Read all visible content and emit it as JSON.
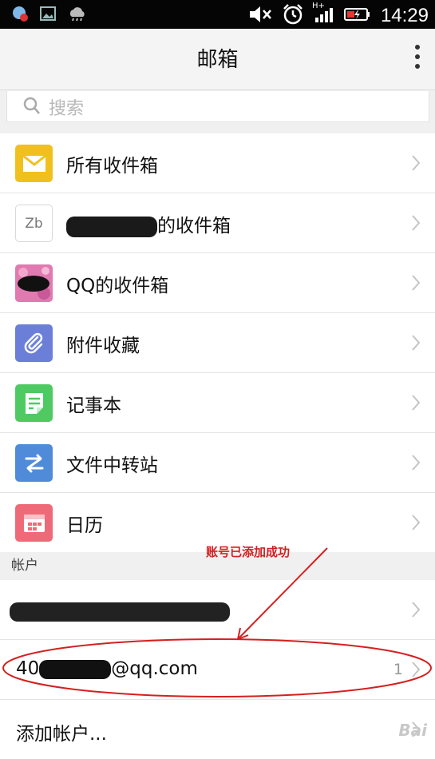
{
  "status_bar": {
    "time": "14:29",
    "network": "H+"
  },
  "header": {
    "title": "邮箱"
  },
  "search": {
    "placeholder": "搜索"
  },
  "folders": [
    {
      "label": "所有收件箱",
      "icon": "envelope-icon",
      "color": "#f2c01d"
    },
    {
      "label": "的收件箱",
      "icon": "avatar-zb",
      "icon_text": "Zb",
      "color": "#ffffff"
    },
    {
      "label": "QQ的收件箱",
      "icon": "avatar-photo",
      "color": "#e07ab0"
    },
    {
      "label": "附件收藏",
      "icon": "paperclip-icon",
      "color": "#6b7fd8"
    },
    {
      "label": "记事本",
      "icon": "note-icon",
      "color": "#4fca63"
    },
    {
      "label": "文件中转站",
      "icon": "transfer-icon",
      "color": "#4f8bd8"
    },
    {
      "label": "日历",
      "icon": "calendar-icon",
      "color": "#ef6a78"
    }
  ],
  "accounts_section": {
    "title": "帐户"
  },
  "accounts": [
    {
      "label": "",
      "count": ""
    },
    {
      "label": "40",
      "label_suffix": "@qq.com",
      "count": "1"
    }
  ],
  "add_account": {
    "label": "添加帐户..."
  },
  "annotation": {
    "text": "账号已添加成功",
    "color": "#d42020"
  },
  "watermark": {
    "text": "Bai"
  }
}
